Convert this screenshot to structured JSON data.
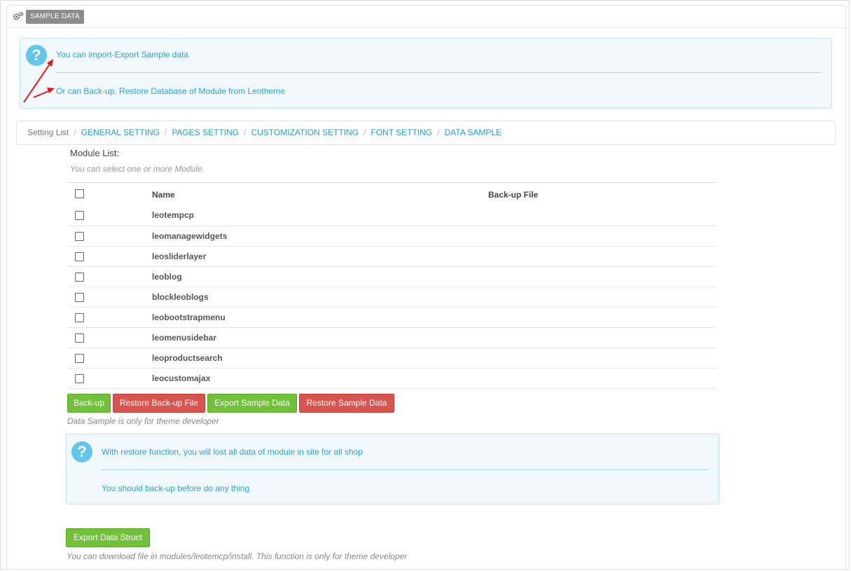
{
  "header": {
    "badge": "SAMPLE DATA",
    "icon": "gears-icon"
  },
  "intro": {
    "line1": "You can import-Export Sample data",
    "line2": "Or can Back-up, Restore Database of Module from Leotheme"
  },
  "breadcrumb": {
    "root": "Setting List",
    "links": [
      "GENERAL SETTING",
      "PAGES SETTING",
      "CUSTOMIZATION SETTING",
      "FONT SETTING",
      "DATA SAMPLE"
    ]
  },
  "modules": {
    "label": "Module List:",
    "help": "You can select one or more Module.",
    "col_name": "Name",
    "col_backup": "Back-up File",
    "items": [
      "leotempcp",
      "leomanagewidgets",
      "leosliderlayer",
      "leoblog",
      "blockleoblogs",
      "leobootstrapmenu",
      "leomenusidebar",
      "leoproductsearch",
      "leocustomajax"
    ]
  },
  "actions": {
    "backup": "Back-up",
    "restore_file": "Restore Back-up File",
    "export_sample": "Export Sample Data",
    "restore_sample": "Restore Sample Data",
    "note": "Data Sample is only for theme developer"
  },
  "warning": {
    "line1": "With restore function, you will lost all data of module in site for all shop",
    "line2": "You should back-up before do any thing"
  },
  "struct": {
    "button": "Export Data Struct",
    "note": "You can download file in modules/leotemcp/install. This function is only for theme developer"
  },
  "colors": {
    "accent": "#1fa0cf",
    "green": "#72c13a",
    "red": "#d9534f",
    "annotation": "#e8141b"
  }
}
